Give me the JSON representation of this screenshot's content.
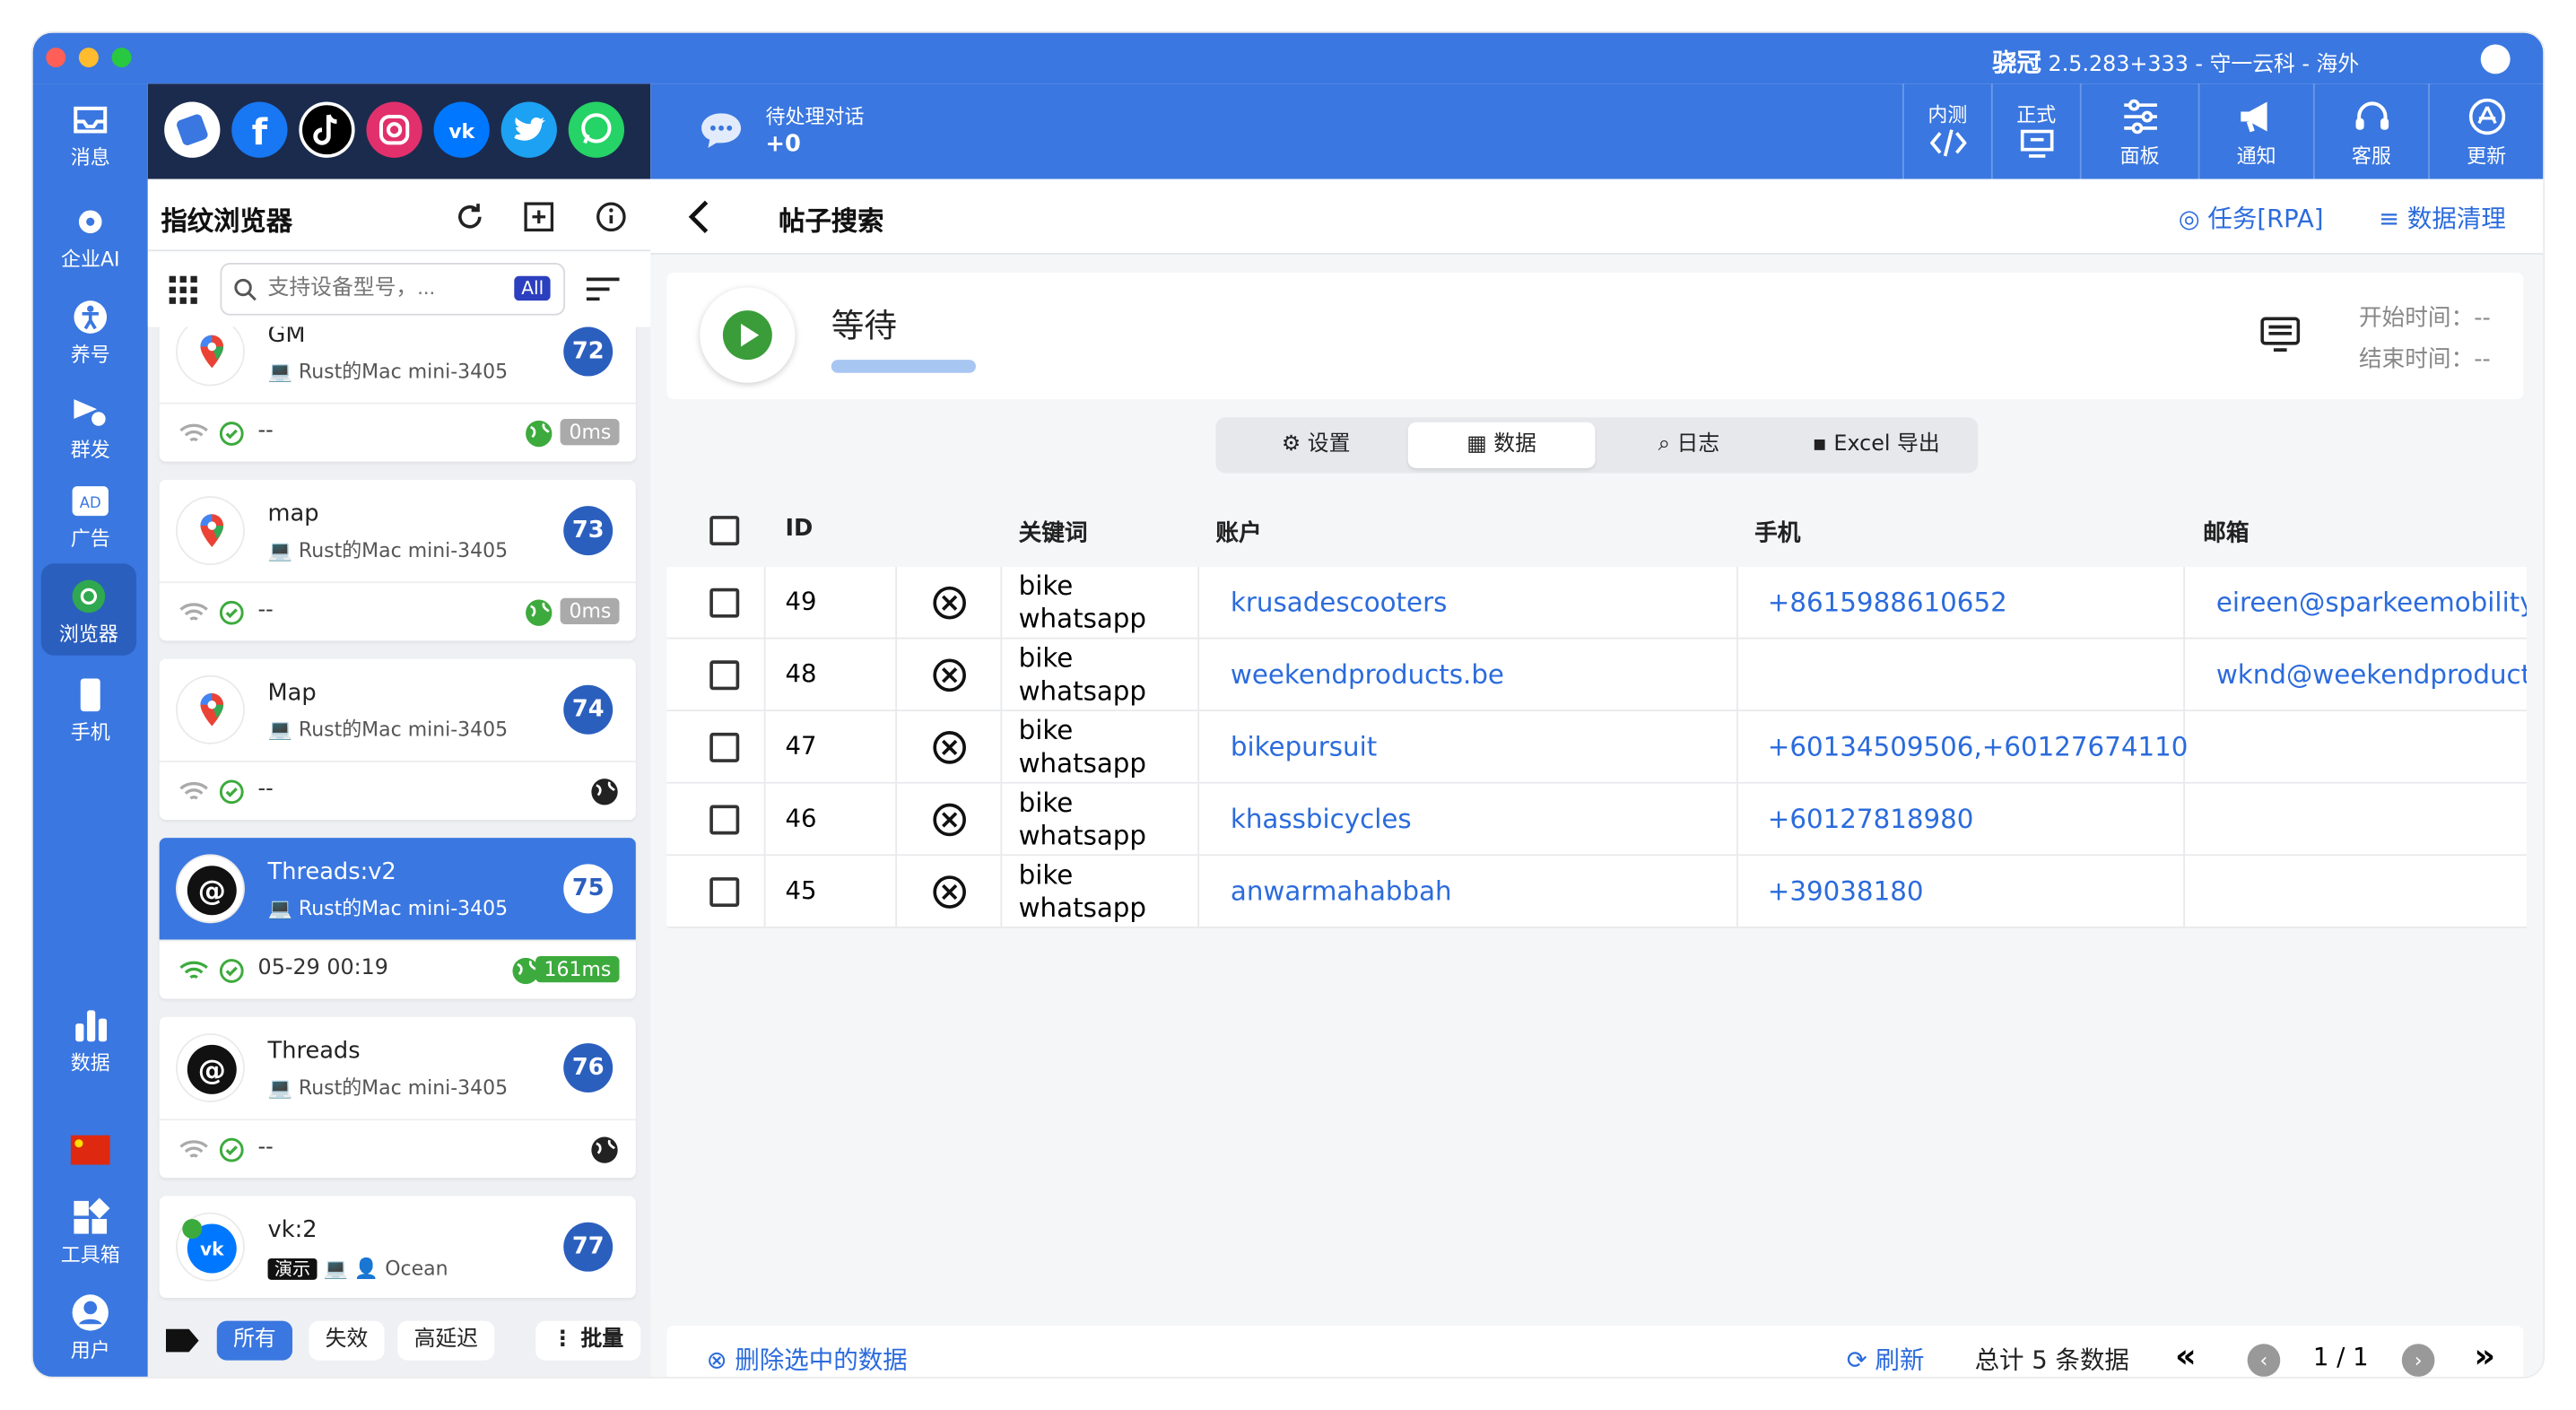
{
  "window": {
    "title_brand": "骁冠",
    "title_rest": " 2.5.283+333 - 守一云科 - 海外"
  },
  "rail": [
    {
      "label": "消息",
      "icon": "inbox-icon"
    },
    {
      "label": "企业AI",
      "icon": "ai-gear-icon"
    },
    {
      "label": "养号",
      "icon": "person-icon"
    },
    {
      "label": "群发",
      "icon": "broadcast-icon"
    },
    {
      "label": "广告",
      "icon": "ad-icon"
    },
    {
      "label": "浏览器",
      "icon": "chrome-icon"
    },
    {
      "label": "手机",
      "icon": "phone-icon"
    },
    {
      "label": "数据",
      "icon": "bar-chart-icon"
    },
    {
      "label": "工具箱",
      "icon": "toolbox-icon"
    },
    {
      "label": "用户",
      "icon": "user-icon"
    }
  ],
  "social_icons": [
    "browser-app-icon",
    "facebook-icon",
    "tiktok-icon",
    "instagram-icon",
    "vk-icon",
    "twitter-icon",
    "whatsapp-icon"
  ],
  "profiles": {
    "title": "指纹浏览器",
    "search_placeholder": "支持设备型号，...",
    "search_badge": "All",
    "items": [
      {
        "name": "GM",
        "device": "Rust的Mac mini-3405",
        "num": "72",
        "status": "--",
        "latency": "0ms",
        "icon": "google-maps-icon"
      },
      {
        "name": "map",
        "device": "Rust的Mac mini-3405",
        "num": "73",
        "status": "--",
        "latency": "0ms",
        "icon": "google-maps-icon"
      },
      {
        "name": "Map",
        "device": "Rust的Mac mini-3405",
        "num": "74",
        "status": "--",
        "latency": "",
        "icon": "google-maps-icon"
      },
      {
        "name": "Threads:v2",
        "device": "Rust的Mac mini-3405",
        "num": "75",
        "status": "05-29 00:19",
        "latency": "161ms",
        "icon": "threads-icon"
      },
      {
        "name": "Threads",
        "device": "Rust的Mac mini-3405",
        "num": "76",
        "status": "--",
        "latency": "",
        "icon": "threads-icon"
      },
      {
        "name": "vk:2",
        "device": "Ocean",
        "tag": "演示",
        "num": "77",
        "icon": "vk-icon"
      }
    ],
    "filters": [
      "所有",
      "失效",
      "高延迟"
    ],
    "batch": "批量"
  },
  "topbar": {
    "pending_label": "待处理对话",
    "pending_count": "+0",
    "buttons": [
      {
        "label_top": "内测",
        "label": "",
        "icon": "code-icon"
      },
      {
        "label_top": "正式",
        "label": "",
        "icon": "monitor-icon"
      },
      {
        "label": "面板",
        "icon": "sliders-icon"
      },
      {
        "label": "通知",
        "icon": "megaphone-icon"
      },
      {
        "label": "客服",
        "icon": "headset-icon"
      },
      {
        "label": "更新",
        "icon": "app-store-icon"
      }
    ]
  },
  "page": {
    "title": "帖子搜索",
    "task_link": "任务[RPA]",
    "clean_link": "数据清理",
    "status": "等待",
    "progress": 0,
    "start_time": "开始时间：--",
    "end_time": "结束时间：--"
  },
  "tabs": [
    "设置",
    "数据",
    "日志",
    "Excel 导出"
  ],
  "table": {
    "headers": {
      "id": "ID",
      "keyword": "关键词",
      "account": "账户",
      "phone": "手机",
      "email": "邮箱"
    },
    "rows": [
      {
        "id": "49",
        "keyword1": "bike",
        "keyword2": "whatsapp",
        "account": "krusadescooters",
        "phone": "+8615988610652",
        "email": "eireen@sparkeemobility.c"
      },
      {
        "id": "48",
        "keyword1": "bike",
        "keyword2": "whatsapp",
        "account": "weekendproducts.be",
        "phone": "",
        "email": "wknd@weekendproducts"
      },
      {
        "id": "47",
        "keyword1": "bike",
        "keyword2": "whatsapp",
        "account": "bikepursuit",
        "phone": "+60134509506,+60127674110",
        "email": ""
      },
      {
        "id": "46",
        "keyword1": "bike",
        "keyword2": "whatsapp",
        "account": "khassbicycles",
        "phone": "+60127818980",
        "email": ""
      },
      {
        "id": "45",
        "keyword1": "bike",
        "keyword2": "whatsapp",
        "account": "anwarmahabbah",
        "phone": "+39038180",
        "email": ""
      }
    ]
  },
  "footer": {
    "delete": "删除选中的数据",
    "refresh": "刷新",
    "total": "总计 5 条数据",
    "page": "1 / 1"
  },
  "colors": {
    "accent": "#3a77e0",
    "dark": "#1b2b4d",
    "link": "#2b6bdc"
  }
}
